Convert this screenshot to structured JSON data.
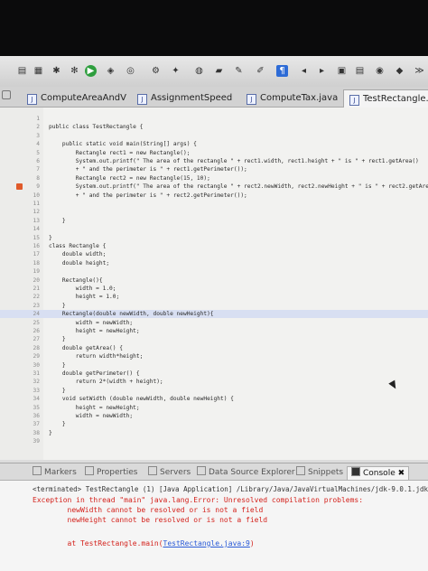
{
  "tabs": [
    {
      "label": "ComputeAreaAndV",
      "icon": "java-file-icon"
    },
    {
      "label": "AssignmentSpeed",
      "icon": "java-file-icon"
    },
    {
      "label": "ComputeTax.java",
      "icon": "java-file-icon"
    },
    {
      "label": "TestRectangle.j",
      "icon": "java-file-icon",
      "active": true
    }
  ],
  "lines": [
    {
      "n": "1",
      "t": ""
    },
    {
      "n": "2",
      "t": "public class TestRectangle {"
    },
    {
      "n": "3",
      "t": ""
    },
    {
      "n": "4",
      "t": "    public static void main(String[] args) {"
    },
    {
      "n": "5",
      "t": "        Rectangle rect1 = new Rectangle();"
    },
    {
      "n": "6",
      "t": "        System.out.printf(\" The area of the rectangle \" + rect1.width, rect1.height + \" is \" + rect1.getArea()"
    },
    {
      "n": "7",
      "t": "        + \" and the perimeter is \" + rect1.getPerimeter());"
    },
    {
      "n": "8",
      "t": "        Rectangle rect2 = new Rectangle(15, 10);"
    },
    {
      "n": "9",
      "t": "        System.out.printf(\" The area of the rectangle \" + rect2.newWidth, rect2.newHeight + \" is \" + rect2.getArea()"
    },
    {
      "n": "10",
      "t": "        + \" and the perimeter is \" + rect2.getPerimeter());"
    },
    {
      "n": "11",
      "t": ""
    },
    {
      "n": "12",
      "t": ""
    },
    {
      "n": "13",
      "t": "    }"
    },
    {
      "n": "14",
      "t": ""
    },
    {
      "n": "15",
      "t": "}"
    },
    {
      "n": "16",
      "t": "class Rectangle {"
    },
    {
      "n": "17",
      "t": "    double width;"
    },
    {
      "n": "18",
      "t": "    double height;"
    },
    {
      "n": "19",
      "t": ""
    },
    {
      "n": "20",
      "t": "    Rectangle(){"
    },
    {
      "n": "21",
      "t": "        width = 1.0;"
    },
    {
      "n": "22",
      "t": "        height = 1.0;"
    },
    {
      "n": "23",
      "t": "    }"
    },
    {
      "n": "24",
      "t": "    Rectangle(double newWidth, double newHeight){"
    },
    {
      "n": "25",
      "t": "        width = newWidth;"
    },
    {
      "n": "26",
      "t": "        height = newHeight;"
    },
    {
      "n": "27",
      "t": "    }"
    },
    {
      "n": "28",
      "t": "    double getArea() {"
    },
    {
      "n": "29",
      "t": "        return width*height;"
    },
    {
      "n": "30",
      "t": "    }"
    },
    {
      "n": "31",
      "t": "    double getPerimeter() {"
    },
    {
      "n": "32",
      "t": "        return 2*(width + height);"
    },
    {
      "n": "33",
      "t": "    }"
    },
    {
      "n": "34",
      "t": "    void setWidth (double newWidth, double newHeight) {"
    },
    {
      "n": "35",
      "t": "        height = newHeight;"
    },
    {
      "n": "36",
      "t": "        width = newWidth;"
    },
    {
      "n": "37",
      "t": "    }"
    },
    {
      "n": "38",
      "t": "}"
    },
    {
      "n": "39",
      "t": ""
    }
  ],
  "bottom_tabs": [
    {
      "label": "Markers"
    },
    {
      "label": "Properties"
    },
    {
      "label": "Servers"
    },
    {
      "label": "Data Source Explorer"
    },
    {
      "label": "Snippets"
    },
    {
      "label": "Console ✖",
      "active": true
    }
  ],
  "console": {
    "terminated": "<terminated> TestRectangle (1) [Java Application] /Library/Java/JavaVirtualMachines/jdk-9.0.1.jdk/Conte",
    "exception": "Exception in thread \"main\" java.lang.Error: Unresolved compilation problems:",
    "err1": "        newWidth cannot be resolved or is not a field",
    "err2": "        newHeight cannot be resolved or is not a field",
    "at_prefix": "        at TestRectangle.main(",
    "at_link": "TestRectangle.java:9",
    "at_suffix": ")"
  }
}
